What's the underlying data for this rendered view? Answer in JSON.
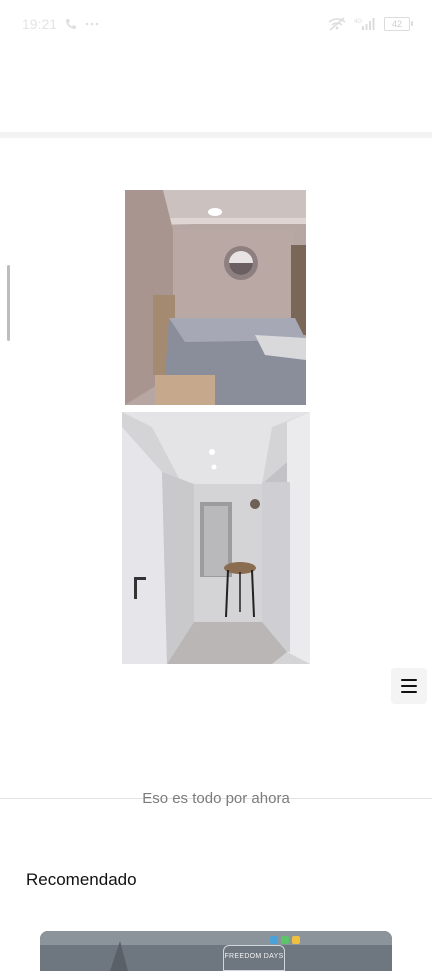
{
  "status_bar": {
    "time": "19:21",
    "battery": "42",
    "icons": [
      "phone-icon",
      "wifi-off-icon",
      "signal-icon",
      "battery-icon"
    ]
  },
  "images": [
    {
      "name": "bedroom-photo",
      "alt": "Dormitorio"
    },
    {
      "name": "hallway-photo",
      "alt": "Pasillo"
    }
  ],
  "menu": {
    "icon": "hamburger-menu-icon"
  },
  "feed_end": {
    "text": "Eso es todo por ahora"
  },
  "recommended": {
    "title": "Recomendado",
    "card_badge": "FREEDOM DAYS"
  }
}
